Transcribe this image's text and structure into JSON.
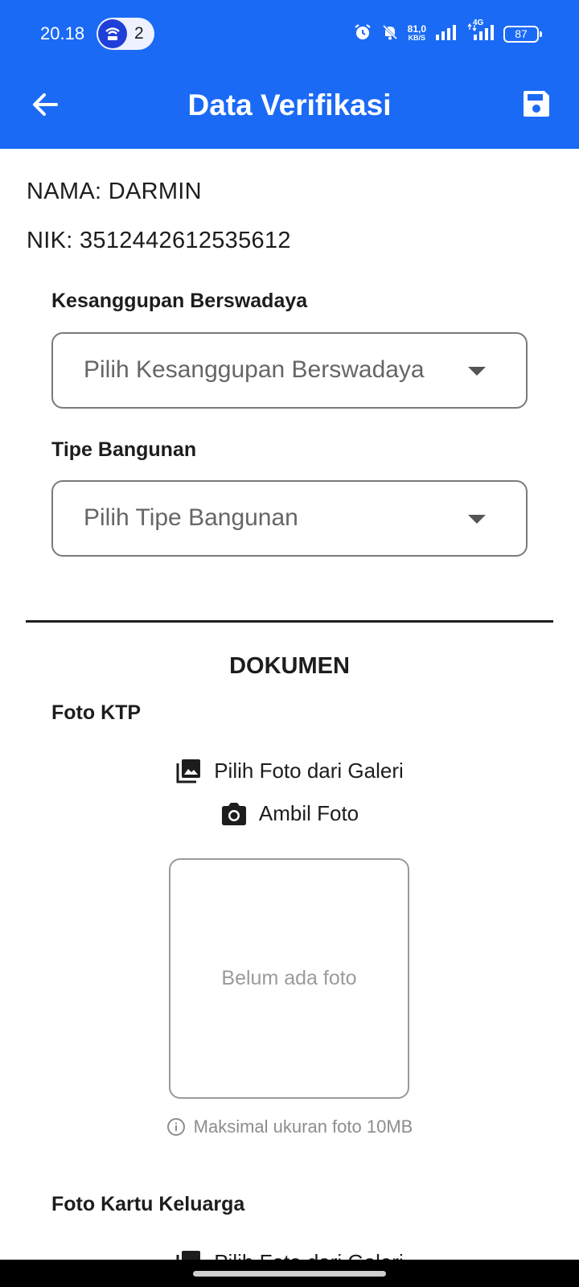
{
  "status_bar": {
    "time": "20.18",
    "hotspot_count": "2",
    "net_speed_value": "81,0",
    "net_speed_unit": "KB/S",
    "network_type": "4G",
    "battery": "87"
  },
  "app_bar": {
    "title": "Data Verifikasi"
  },
  "profile": {
    "name_line": "NAMA: DARMIN",
    "nik_line": "NIK: 3512442612535612"
  },
  "form": {
    "kesanggupan_label": "Kesanggupan Berswadaya",
    "kesanggupan_placeholder": "Pilih Kesanggupan Berswadaya",
    "tipe_label": "Tipe Bangunan",
    "tipe_placeholder": "Pilih Tipe Bangunan"
  },
  "dokumen": {
    "section_title": "DOKUMEN",
    "ktp": {
      "label": "Foto KTP",
      "gallery_label": "Pilih Foto dari Galeri",
      "camera_label": "Ambil Foto",
      "placeholder": "Belum ada foto",
      "hint": "Maksimal ukuran foto 10MB"
    },
    "kk": {
      "label": "Foto Kartu Keluarga",
      "gallery_label": "Pilih Foto dari Galeri"
    }
  },
  "icons": {
    "back": "arrow-left-icon",
    "save": "floppy-disk-icon",
    "gallery": "photo-library-icon",
    "camera": "camera-icon",
    "info": "info-icon",
    "dropdown": "caret-down-icon"
  },
  "colors": {
    "primary": "#1a6af5",
    "text": "#1d1d1d",
    "placeholder": "#666666",
    "hint": "#8d8d8d"
  }
}
